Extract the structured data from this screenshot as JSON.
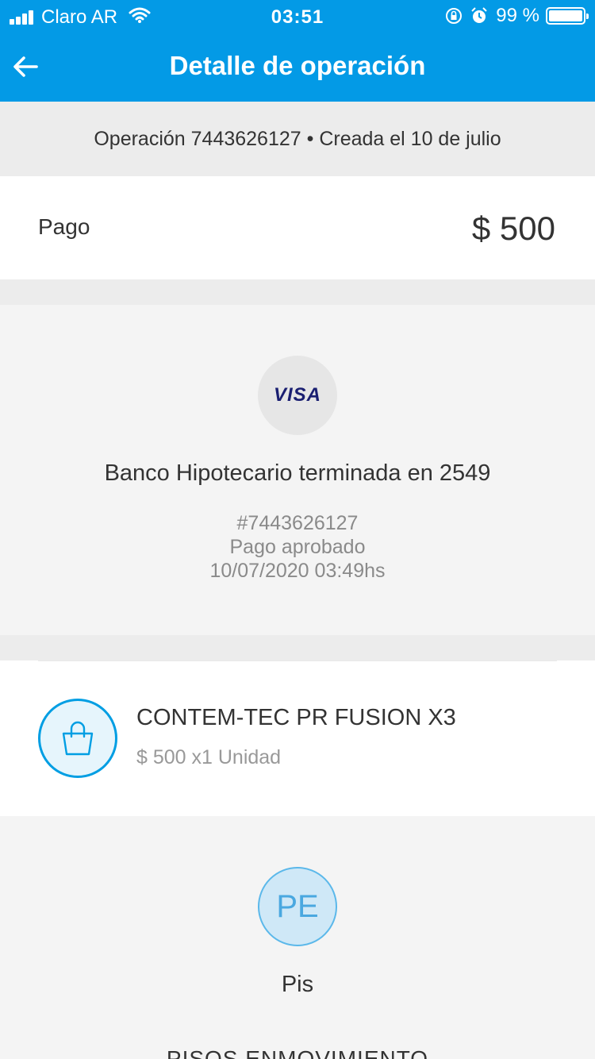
{
  "status_bar": {
    "carrier": "Claro AR",
    "time": "03:51",
    "battery_text": "99 %",
    "battery_level": 0.99
  },
  "nav": {
    "title": "Detalle de operación",
    "back_icon": "arrow-left-icon"
  },
  "operation": {
    "header": "Operación 7443626127 • Creada el 10 de julio"
  },
  "payment": {
    "label": "Pago",
    "amount": "$ 500"
  },
  "card": {
    "brand": "VISA",
    "bank": "Banco Hipotecario terminada en 2549",
    "op_number": "#7443626127",
    "status": "Pago aprobado",
    "datetime": "10/07/2020 03:49hs"
  },
  "item": {
    "icon": "shopping-bag-icon",
    "title": "CONTEM-TEC PR FUSION X3",
    "detail": "$ 500 x1 Unidad"
  },
  "seller": {
    "initials": "PE",
    "name": "Pis",
    "business": "PISOS ENMOVIMIENTO"
  },
  "colors": {
    "brand_blue": "#039ae6",
    "accent_blue": "#009ee3"
  }
}
